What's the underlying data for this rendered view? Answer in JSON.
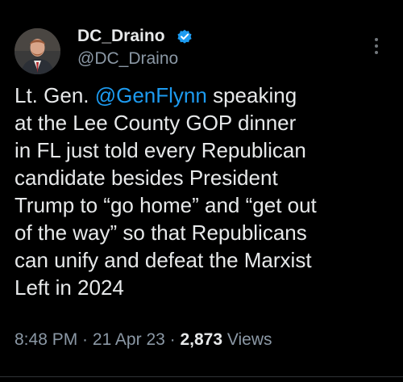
{
  "author": {
    "name": "DC_Draino",
    "handle": "@DC_Draino",
    "verified_color": "#1d9bf0"
  },
  "tweet": {
    "lines": [
      {
        "pre": "Lt. Gen. ",
        "mention": "@GenFlynn",
        "post": " speaking"
      },
      {
        "text": "at the Lee County GOP dinner"
      },
      {
        "text": "in FL just told every Republican"
      },
      {
        "text": "candidate besides President"
      },
      {
        "text": "Trump to “go home” and “get out"
      },
      {
        "text": "of the way” so that Republicans"
      },
      {
        "text": "can unify and defeat the Marxist"
      },
      {
        "text": "Left in 2024"
      }
    ]
  },
  "meta": {
    "time": "8:48 PM",
    "sep1": " · ",
    "date": "21 Apr 23",
    "sep2": " · ",
    "views_count": "2,873",
    "views_label": " Views"
  },
  "colors": {
    "background": "#000000",
    "text": "#e7e9ea",
    "secondary": "#8b98a5",
    "link": "#1d9bf0"
  },
  "icons": {
    "verified": "verified-badge-icon",
    "more": "more-options-icon"
  }
}
